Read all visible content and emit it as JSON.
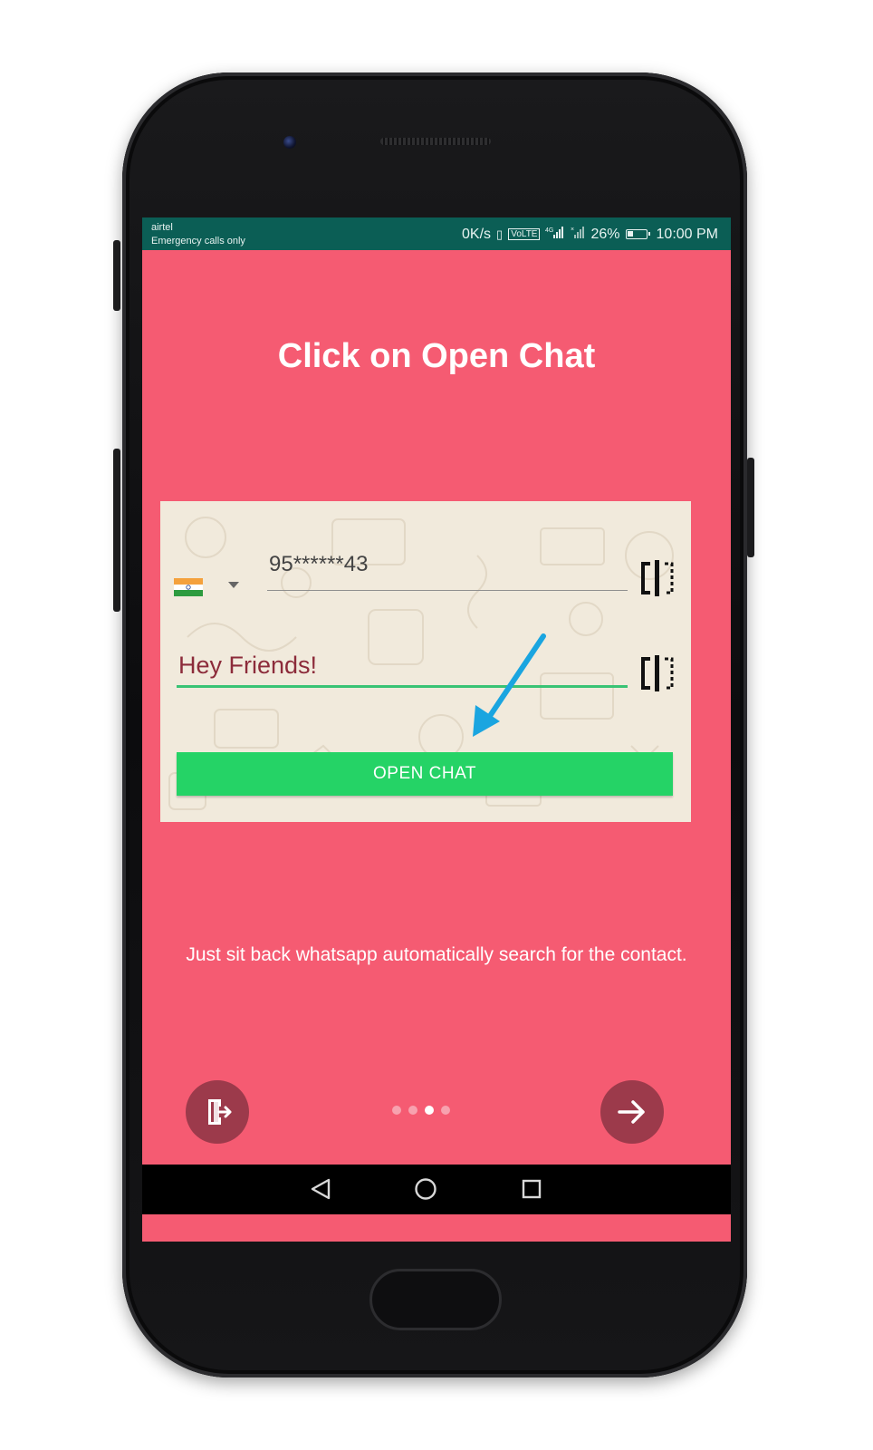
{
  "status_bar": {
    "carrier": "airtel",
    "carrier_status": "Emergency calls only",
    "data_speed": "0K/s",
    "network": "4G",
    "battery": "26%",
    "time": "10:00 PM"
  },
  "screen": {
    "title": "Click on Open Chat",
    "card": {
      "phone_number": "95******43",
      "message": "Hey Friends!",
      "open_chat_label": "OPEN CHAT"
    },
    "description": "Just sit back whatsapp automatically search for the contact.",
    "pager": {
      "count": 4,
      "active_index": 2
    }
  },
  "colors": {
    "background": "#f55b72",
    "status_bar": "#0b5e55",
    "fab": "#9c3a4b",
    "open_chat": "#25d366",
    "arrow": "#1aa5e0"
  },
  "icons": {
    "skip": "exit-door-icon",
    "next": "arrow-right-icon",
    "nav_back": "triangle-back-icon",
    "nav_home": "circle-home-icon",
    "nav_recents": "square-recents-icon",
    "paste": "paste-field-icon"
  }
}
